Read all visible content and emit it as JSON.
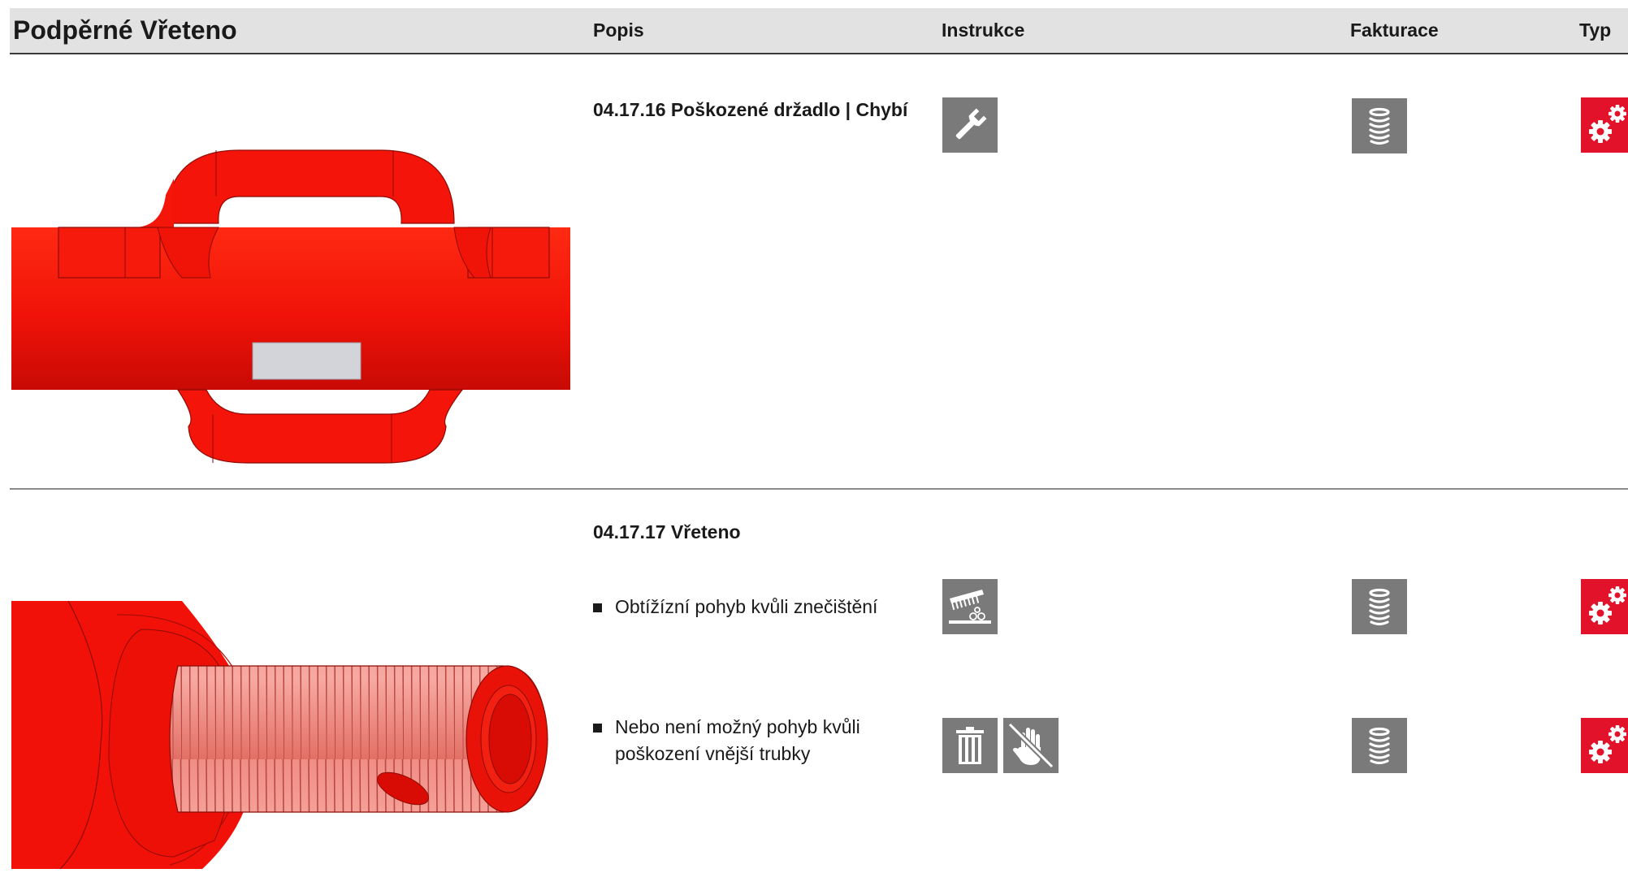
{
  "header": {
    "title": "Podpěrné Vřeteno",
    "columns": {
      "popis": "Popis",
      "instrukce": "Instrukce",
      "fakturace": "Fakturace",
      "typ": "Typ"
    }
  },
  "colors": {
    "header_bg": "#e2e2e2",
    "icon_gray": "#7a7a7a",
    "type_red": "#e3122b",
    "part_red": "#ff1a0a"
  },
  "sections": [
    {
      "code_title": "04.17.16 Poškozené držadlo | Chybí",
      "image": "spindle-with-handles",
      "rows": [
        {
          "instructions": [
            "wrench-icon"
          ],
          "billing": "stack-icon",
          "type": "gears-icon"
        }
      ]
    },
    {
      "code_title": "04.17.17 Vřeteno",
      "image": "threaded-spindle",
      "rows": [
        {
          "text": "Obtížízní pohyb kvůli znečištění",
          "instructions": [
            "brush-cleaning-icon"
          ],
          "billing": "stack-icon",
          "type": "gears-icon"
        },
        {
          "text": "Nebo není možný pohyb kvůli poškození vnější trubky",
          "instructions": [
            "trash-icon",
            "no-hand-icon"
          ],
          "billing": "stack-icon",
          "type": "gears-icon"
        }
      ]
    }
  ]
}
